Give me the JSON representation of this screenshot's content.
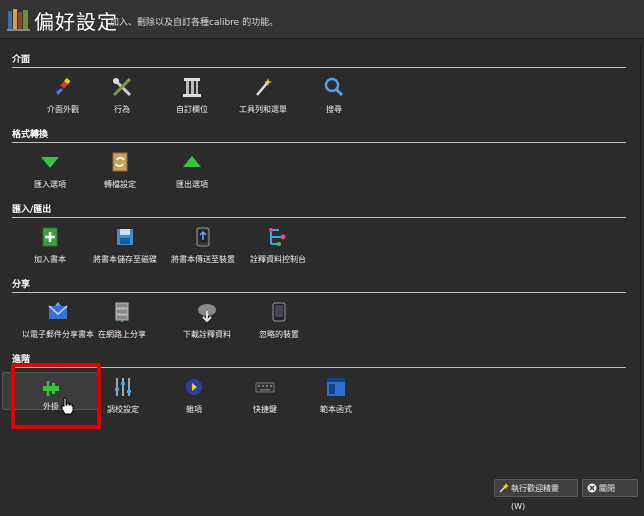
{
  "header": {
    "title": "偏好設定",
    "subtitle": "加入、刪除以及自訂各種calibre 的功能。"
  },
  "sections": [
    {
      "title": "介面",
      "items": [
        {
          "label": "介面外觀",
          "icon": "brush-icon"
        },
        {
          "label": "行為",
          "icon": "tools-icon"
        },
        {
          "label": "自訂欄位",
          "icon": "column-icon"
        },
        {
          "label": "工具列和選單",
          "icon": "magic-wand-icon"
        },
        {
          "label": "搜尋",
          "icon": "search-icon"
        }
      ]
    },
    {
      "title": "格式轉換",
      "items": [
        {
          "label": "匯入選項",
          "icon": "arrow-down-icon"
        },
        {
          "label": "轉檔設定",
          "icon": "convert-icon"
        },
        {
          "label": "匯出選項",
          "icon": "arrow-up-icon"
        }
      ]
    },
    {
      "title": "匯入/匯出",
      "items": [
        {
          "label": "加入書本",
          "icon": "add-book-icon"
        },
        {
          "label": "將書本儲存至磁碟",
          "icon": "save-disk-icon"
        },
        {
          "label": "將書本傳送至裝置",
          "icon": "send-device-icon"
        },
        {
          "label": "詮釋資料控制台",
          "icon": "metadata-icon"
        }
      ]
    },
    {
      "title": "分享",
      "items": [
        {
          "label": "以電子郵件分享書本",
          "icon": "email-icon"
        },
        {
          "label": "在網路上分享",
          "icon": "server-icon"
        },
        {
          "label": "下載詮釋資料",
          "icon": "cloud-download-icon"
        },
        {
          "label": "忽略的裝置",
          "icon": "tablet-icon"
        }
      ]
    },
    {
      "title": "進階",
      "items": [
        {
          "label": "外掛",
          "icon": "plugin-icon"
        },
        {
          "label": "調校設定",
          "icon": "sliders-icon"
        },
        {
          "label": "雜項",
          "icon": "misc-icon"
        },
        {
          "label": "快捷鍵",
          "icon": "keyboard-icon"
        },
        {
          "label": "範本函式",
          "icon": "template-icon"
        }
      ]
    }
  ],
  "footer": {
    "wizard_label": "執行歡迎精靈(W)",
    "close_label": "關閉"
  },
  "colors": {
    "background": "#2b2b2b",
    "highlight": "#e00000"
  }
}
